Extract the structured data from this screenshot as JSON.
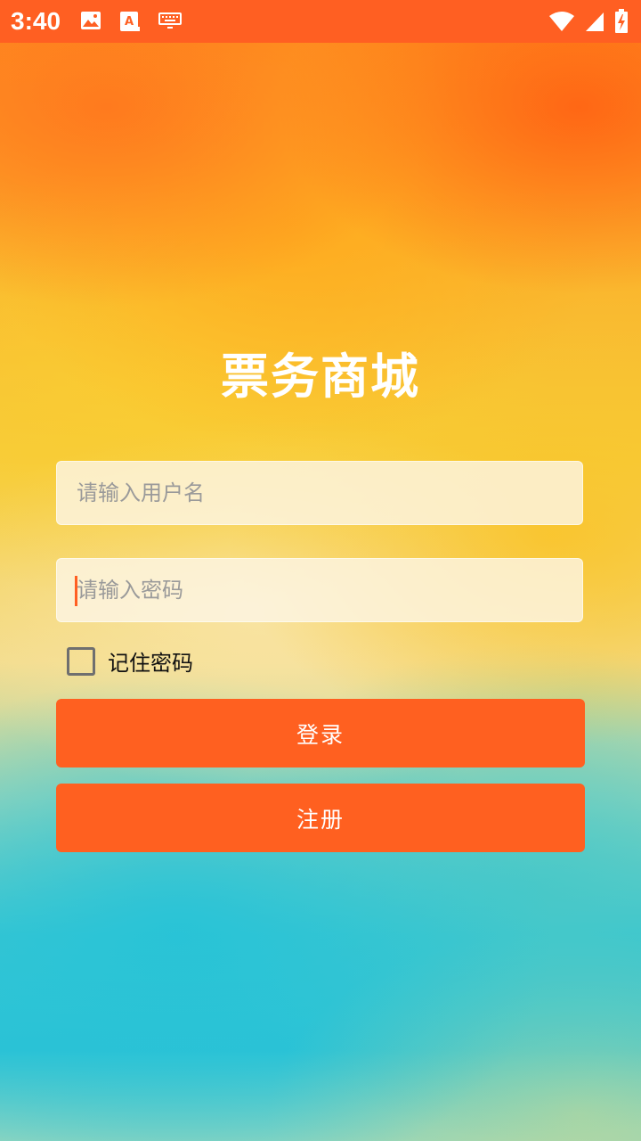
{
  "status_bar": {
    "time": "3:40",
    "left_icons": [
      "image-icon",
      "text-a-icon",
      "keyboard-icon"
    ],
    "right_icons": [
      "wifi-icon",
      "cell-signal-icon",
      "battery-charging-icon"
    ],
    "color": "#ff5f22"
  },
  "app": {
    "title": "票务商城"
  },
  "form": {
    "username": {
      "placeholder": "请输入用户名",
      "value": ""
    },
    "password": {
      "placeholder": "请输入密码",
      "value": ""
    },
    "remember": {
      "label": "记住密码",
      "checked": false
    },
    "login_label": "登录",
    "register_label": "注册"
  },
  "colors": {
    "accent": "#ff6020",
    "title_text": "#ffffff"
  }
}
